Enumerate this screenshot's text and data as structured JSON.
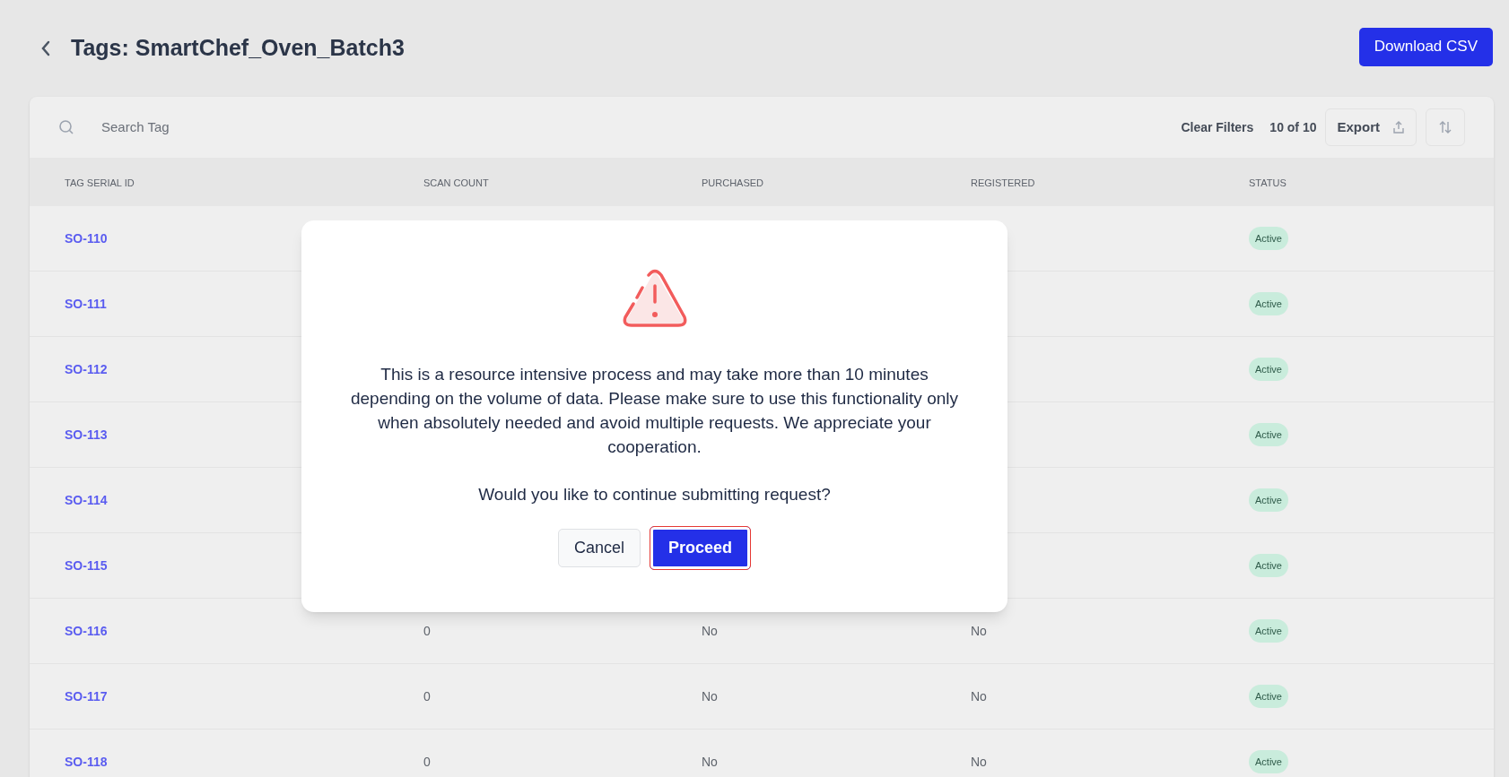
{
  "header": {
    "title": "Tags: SmartChef_Oven_Batch3",
    "download_button": "Download CSV"
  },
  "toolbar": {
    "search_placeholder": "Search Tag",
    "clear_filters": "Clear Filters",
    "count": "10 of 10",
    "export_button": "Export"
  },
  "table": {
    "columns": [
      "TAG SERIAL ID",
      "SCAN COUNT",
      "PURCHASED",
      "REGISTERED",
      "STATUS"
    ],
    "rows": [
      {
        "serial_id": "SO-110",
        "status": "Active"
      },
      {
        "serial_id": "SO-111",
        "status": "Active"
      },
      {
        "serial_id": "SO-112",
        "status": "Active"
      },
      {
        "serial_id": "SO-113",
        "status": "Active"
      },
      {
        "serial_id": "SO-114",
        "status": "Active"
      },
      {
        "serial_id": "SO-115",
        "status": "Active"
      },
      {
        "serial_id": "SO-116",
        "scan_count": "0",
        "purchased": "No",
        "registered": "No",
        "status": "Active"
      },
      {
        "serial_id": "SO-117",
        "scan_count": "0",
        "purchased": "No",
        "registered": "No",
        "status": "Active"
      },
      {
        "serial_id": "SO-118",
        "scan_count": "0",
        "purchased": "No",
        "registered": "No",
        "status": "Active"
      }
    ]
  },
  "dialog": {
    "message": "This is a resource intensive process and may take more than 10 minutes depending on the volume of data. Please make sure to use this functionality only when absolutely needed and avoid multiple requests. We appreciate your cooperation.",
    "question": "Would you like to continue submitting request?",
    "buttons": [
      {
        "label": "Cancel",
        "kind": "secondary",
        "focused": false
      },
      {
        "label": "Proceed",
        "kind": "primary",
        "focused": true
      }
    ]
  }
}
